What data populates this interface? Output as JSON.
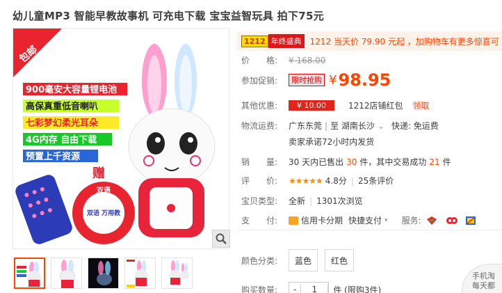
{
  "title": "幼儿童MP3 智能早教故事机 可充电下载 宝宝益智玩具 拍下75元",
  "promo": {
    "badge_a": "1212",
    "badge_b": "年终盛典",
    "text": "1212 当天价 79.90 元起 ，加购物车有更多惊喜可"
  },
  "image_texts": {
    "corner_tag": "包邮",
    "features": [
      "900毫安大容量锂电池",
      "高保真重低音喇叭",
      "七彩梦幻柔光耳朵",
      "4G内存 自由下载",
      "预置上千资源"
    ],
    "gift": "赠",
    "book_title_a": "双语",
    "book_title_b": "双语 万用教"
  },
  "price": {
    "label": "价　　格:",
    "value": "¥ 168.00"
  },
  "promotion": {
    "label": "参加促销:",
    "tag": "限时抢购",
    "yen": "¥",
    "value": "98.95"
  },
  "other": {
    "label": "其他优惠:",
    "coupon": "¥ 10.00",
    "text": "1212店铺红包",
    "link": "领取"
  },
  "logistics": {
    "label": "物流运费:",
    "from": "广东东莞",
    "sep": "|",
    "to": "至  湖南长沙",
    "chevron": "⌄",
    "fee": "快递: 免运费",
    "note": "卖家承诺72小时内发货"
  },
  "sales": {
    "label": "销　　量:",
    "text_a": "30 天内已售出",
    "count_a": "30",
    "text_b": "件，其中交易成功",
    "count_b": "21",
    "text_c": "件"
  },
  "rating": {
    "label": "评　　价:",
    "stars": "★★★★★",
    "score": "4.8分",
    "sep": "|",
    "reviews": "25条评价"
  },
  "type": {
    "label": "宝贝类型:",
    "value": "全新",
    "sep": "|",
    "views": "1301次浏览"
  },
  "payment": {
    "label": "支　　付:",
    "credit": "信用卡分期",
    "quick": "快捷支付",
    "service": "服务:"
  },
  "color": {
    "label": "颜色分类:",
    "options": [
      "蓝色",
      "红色"
    ]
  },
  "quantity": {
    "label": "购买数量:",
    "minus": "-",
    "value": "1",
    "note": "件 (限购3件)"
  },
  "corner": {
    "line1": "手机淘",
    "line2": "每天都"
  },
  "colors": {
    "accent": "#ff4400",
    "promo_bg": "#fff2e8"
  }
}
